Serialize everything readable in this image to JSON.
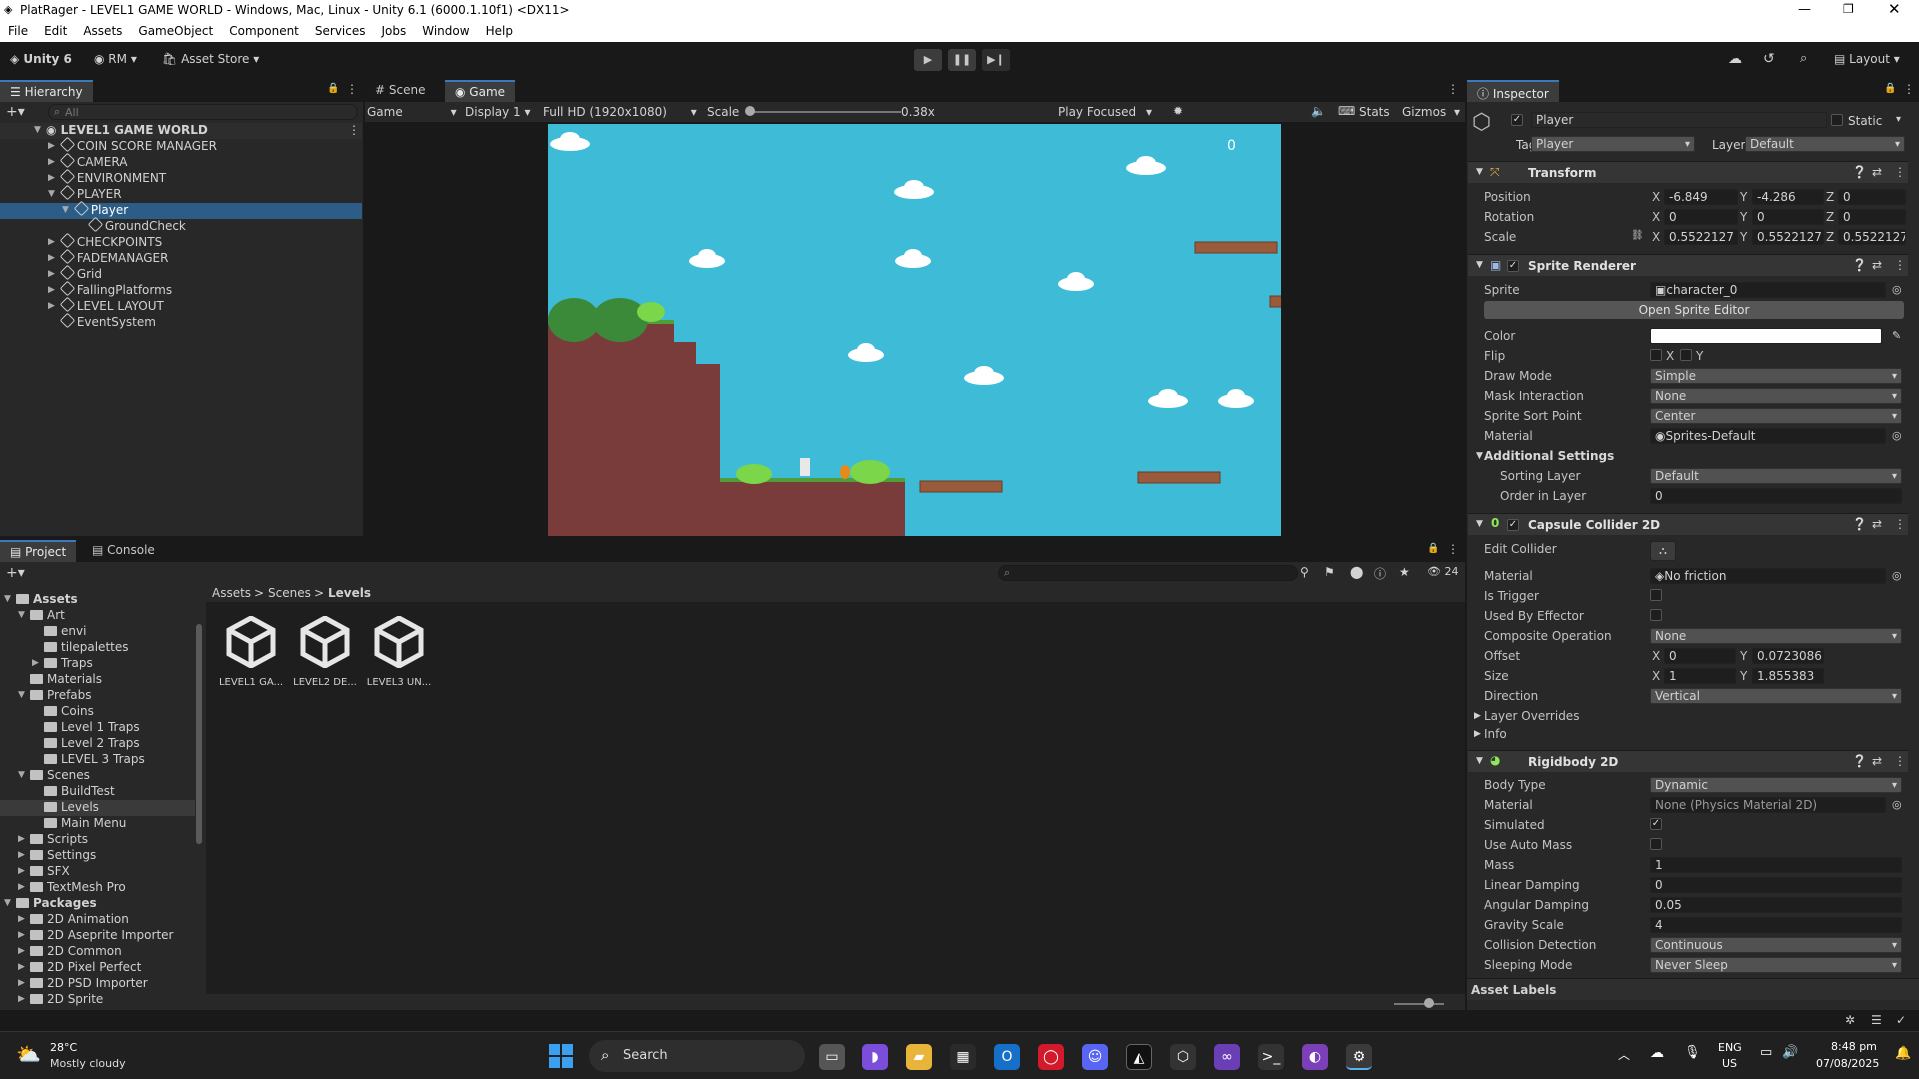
{
  "window": {
    "title": "PlatRager - LEVEL1 GAME WORLD - Windows, Mac, Linux - Unity 6.1 (6000.1.10f1) <DX11>"
  },
  "menu": [
    "File",
    "Edit",
    "Assets",
    "GameObject",
    "Component",
    "Services",
    "Jobs",
    "Window",
    "Help"
  ],
  "toolbar": {
    "unity": "Unity 6",
    "account": "RM",
    "asset_store": "Asset Store",
    "layout": "Layout"
  },
  "hierarchy": {
    "tab": "Hierarchy",
    "search_placeholder": "All",
    "scene": "LEVEL1 GAME WORLD",
    "items": [
      "COIN SCORE MANAGER",
      "CAMERA",
      "ENVIRONMENT",
      "PLAYER",
      "Player",
      "GroundCheck",
      "CHECKPOINTS",
      "FADEMANAGER",
      "Grid",
      "FallingPlatforms",
      "LEVEL LAYOUT",
      "EventSystem"
    ]
  },
  "game": {
    "tabs": [
      "Scene",
      "Game"
    ],
    "mode": "Game",
    "display": "Display 1",
    "resolution": "Full HD (1920x1080)",
    "scale_label": "Scale",
    "scale_value": "0.38x",
    "play_focused": "Play Focused",
    "stats": "Stats",
    "gizmos": "Gizmos",
    "score": "0"
  },
  "project": {
    "tabs": [
      "Project",
      "Console"
    ],
    "count": "24",
    "breadcrumb": [
      "Assets",
      "Scenes",
      "Levels"
    ],
    "tree": [
      "Assets",
      "Art",
      "envi",
      "tilepalettes",
      "Traps",
      "Materials",
      "Prefabs",
      "Coins",
      "Level 1 Traps",
      "Level 2 Traps",
      "LEVEL 3 Traps",
      "Scenes",
      "BuildTest",
      "Levels",
      "Main Menu",
      "Scripts",
      "Settings",
      "SFX",
      "TextMesh Pro",
      "Packages",
      "2D Animation",
      "2D Aseprite Importer",
      "2D Common",
      "2D Pixel Perfect",
      "2D PSD Importer",
      "2D Sprite"
    ],
    "assets": [
      "LEVEL1 GA...",
      "LEVEL2 DE...",
      "LEVEL3 UN..."
    ]
  },
  "inspector": {
    "tab": "Inspector",
    "name": "Player",
    "static": "Static",
    "tag_label": "Tag",
    "tag": "Player",
    "layer_label": "Layer",
    "layer": "Default",
    "transform": {
      "title": "Transform",
      "position_label": "Position",
      "rotation_label": "Rotation",
      "scale_label": "Scale",
      "px": "-6.849",
      "py": "-4.286",
      "pz": "0",
      "rx": "0",
      "ry": "0",
      "rz": "0",
      "sx": "0.5522127",
      "sy": "0.5522127",
      "sz": "0.5522127"
    },
    "sprite_renderer": {
      "title": "Sprite Renderer",
      "sprite_label": "Sprite",
      "sprite": "character_0",
      "open_editor": "Open Sprite Editor",
      "color_label": "Color",
      "flip_label": "Flip",
      "flip_x": "X",
      "flip_y": "Y",
      "draw_mode_label": "Draw Mode",
      "draw_mode": "Simple",
      "mask_label": "Mask Interaction",
      "mask": "None",
      "sort_point_label": "Sprite Sort Point",
      "sort_point": "Center",
      "material_label": "Material",
      "material": "Sprites-Default",
      "additional": "Additional Settings",
      "sorting_layer_label": "Sorting Layer",
      "sorting_layer": "Default",
      "order_label": "Order in Layer",
      "order": "0"
    },
    "capsule": {
      "title": "Capsule Collider 2D",
      "edit_label": "Edit Collider",
      "material_label": "Material",
      "material": "No friction",
      "trigger_label": "Is Trigger",
      "effector_label": "Used By Effector",
      "composite_label": "Composite Operation",
      "composite": "None",
      "offset_label": "Offset",
      "ox": "0",
      "oy": "0.0723086",
      "size_label": "Size",
      "sx": "1",
      "sy": "1.855383",
      "direction_label": "Direction",
      "direction": "Vertical",
      "overrides": "Layer Overrides",
      "info": "Info"
    },
    "rigidbody": {
      "title": "Rigidbody 2D",
      "body_type_label": "Body Type",
      "body_type": "Dynamic",
      "material_label": "Material",
      "material": "None (Physics Material 2D)",
      "simulated_label": "Simulated",
      "auto_mass_label": "Use Auto Mass",
      "mass_label": "Mass",
      "mass": "1",
      "lin_label": "Linear Damping",
      "lin": "0",
      "ang_label": "Angular Damping",
      "ang": "0.05",
      "grav_label": "Gravity Scale",
      "grav": "4",
      "coll_label": "Collision Detection",
      "coll": "Continuous",
      "sleep_label": "Sleeping Mode",
      "sleep": "Never Sleep"
    },
    "asset_labels": "Asset Labels"
  },
  "taskbar": {
    "temp": "28°C",
    "weather": "Mostly cloudy",
    "search": "Search",
    "lang1": "ENG",
    "lang2": "US",
    "time": "8:48 pm",
    "date": "07/08/2025"
  }
}
